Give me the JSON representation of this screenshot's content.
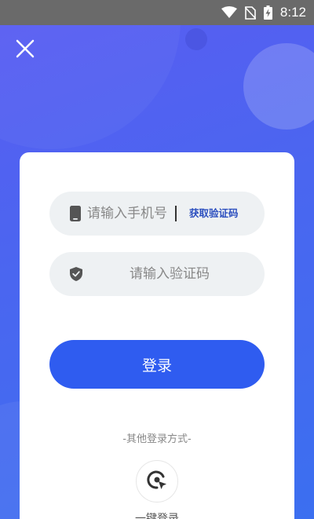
{
  "status_bar": {
    "time": "8:12"
  },
  "login_form": {
    "phone_placeholder": "请输入手机号",
    "get_code_label": "获取验证码",
    "code_placeholder": "请输入验证码",
    "login_button_label": "登录"
  },
  "other_login": {
    "label": "-其他登录方式-",
    "one_click_label": "一键登录"
  },
  "colors": {
    "background": "#4a63ee",
    "primary_button": "#2f5cf0",
    "input_background": "#eef1f3",
    "link": "#2c4fbf"
  },
  "icons": [
    "wifi-icon",
    "no-sim-icon",
    "battery-charging-icon",
    "close-icon",
    "phone-icon",
    "shield-check-icon",
    "one-click-login-icon"
  ]
}
